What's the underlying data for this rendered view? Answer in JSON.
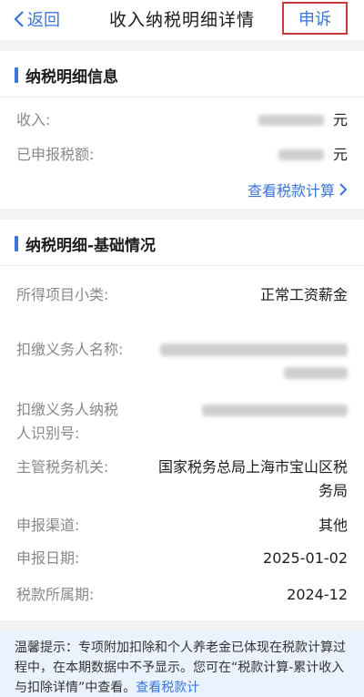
{
  "header": {
    "back_label": "返回",
    "title": "收入纳税明细详情",
    "appeal_label": "申诉"
  },
  "section1": {
    "title": "纳税明细信息",
    "income_label": "收入:",
    "income_unit": "元",
    "declared_tax_label": "已申报税额:",
    "declared_tax_unit": "元",
    "view_tax_calc": "查看税款计算"
  },
  "section2": {
    "title": "纳税明细-基础情况",
    "rows": [
      {
        "label": "所得项目小类:",
        "value": "正常工资薪金"
      },
      {
        "label": "扣缴义务人名称:",
        "value": ""
      },
      {
        "label": "扣缴义务人纳税人识别号:",
        "value": ""
      },
      {
        "label": "主管税务机关:",
        "value": "国家税务总局上海市宝山区税务局"
      },
      {
        "label": "申报渠道:",
        "value": "其他"
      },
      {
        "label": "申报日期:",
        "value": "2025-01-02"
      },
      {
        "label": "税款所属期:",
        "value": "2024-12"
      }
    ]
  },
  "tip": {
    "text": "温馨提示：专项附加扣除和个人养老金已体现在税款计算过程中，在本期数据中不予显示。您可在“税款计算-累计收入与扣除详情”中查看。",
    "link": "查看税款计"
  },
  "colors": {
    "accent": "#3b74d9",
    "highlight_border": "#c83a3a"
  }
}
